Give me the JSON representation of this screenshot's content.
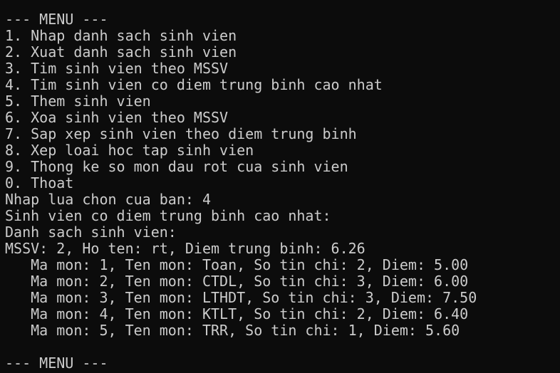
{
  "terminal": {
    "background": "#0c0c0c",
    "foreground": "#cccccc",
    "lines": [
      "--- MENU ---",
      "1. Nhap danh sach sinh vien",
      "2. Xuat danh sach sinh vien",
      "3. Tim sinh vien theo MSSV",
      "4. Tim sinh vien co diem trung binh cao nhat",
      "5. Them sinh vien",
      "6. Xoa sinh vien theo MSSV",
      "7. Sap xep sinh vien theo diem trung binh",
      "8. Xep loai hoc tap sinh vien",
      "9. Thong ke so mon dau rot cua sinh vien",
      "0. Thoat",
      "Nhap lua chon cua ban: 4",
      "Sinh vien co diem trung binh cao nhat:",
      "Danh sach sinh vien:",
      "MSSV: 2, Ho ten: rt, Diem trung binh: 6.26",
      "   Ma mon: 1, Ten mon: Toan, So tin chi: 2, Diem: 5.00",
      "   Ma mon: 2, Ten mon: CTDL, So tin chi: 3, Diem: 6.00",
      "   Ma mon: 3, Ten mon: LTHDT, So tin chi: 3, Diem: 7.50",
      "   Ma mon: 4, Ten mon: KTLT, So tin chi: 2, Diem: 6.40",
      "   Ma mon: 5, Ten mon: TRR, So tin chi: 1, Diem: 5.60",
      "",
      "--- MENU ---"
    ]
  }
}
